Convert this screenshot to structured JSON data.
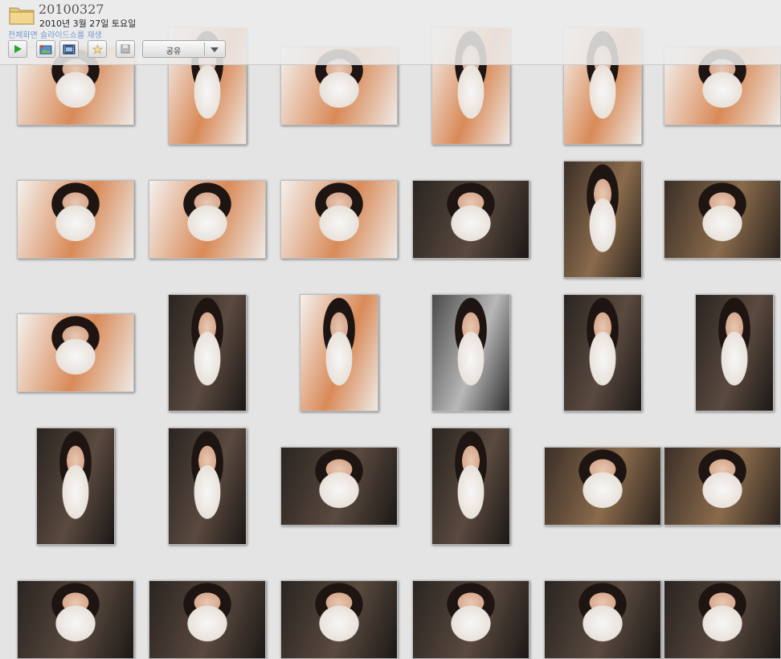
{
  "header": {
    "title": "20100327",
    "date": "2010년 3월 27일 토요일",
    "slideshow_link": "전체화면 슬라이드쇼를 재생",
    "share_label": "공유"
  },
  "toolbar": {
    "buttons": [
      {
        "name": "play-button",
        "icon": "play-icon"
      },
      {
        "name": "add-image-button",
        "icon": "add-image-icon"
      },
      {
        "name": "slideshow-button",
        "icon": "filmstrip-icon"
      },
      {
        "name": "favorite-button",
        "icon": "star-icon"
      },
      {
        "name": "save-button",
        "icon": "save-icon"
      }
    ]
  },
  "photos": [
    {
      "row": 0,
      "col": 0,
      "orientation": "landscape",
      "tone": "orange"
    },
    {
      "row": 0,
      "col": 1,
      "orientation": "portrait",
      "tone": "orange"
    },
    {
      "row": 0,
      "col": 2,
      "orientation": "landscape",
      "tone": "orange"
    },
    {
      "row": 0,
      "col": 3,
      "orientation": "portrait",
      "tone": "orange"
    },
    {
      "row": 0,
      "col": 4,
      "orientation": "portrait",
      "tone": "orange"
    },
    {
      "row": 0,
      "col": 5,
      "orientation": "landscape",
      "tone": "orange"
    },
    {
      "row": 1,
      "col": 0,
      "orientation": "landscape",
      "tone": "orange"
    },
    {
      "row": 1,
      "col": 1,
      "orientation": "landscape",
      "tone": "orange"
    },
    {
      "row": 1,
      "col": 2,
      "orientation": "landscape",
      "tone": "orange"
    },
    {
      "row": 1,
      "col": 3,
      "orientation": "landscape",
      "tone": "dark"
    },
    {
      "row": 1,
      "col": 4,
      "orientation": "portrait",
      "tone": "bokeh"
    },
    {
      "row": 1,
      "col": 5,
      "orientation": "landscape",
      "tone": "bokeh"
    },
    {
      "row": 2,
      "col": 0,
      "orientation": "landscape",
      "tone": "orange"
    },
    {
      "row": 2,
      "col": 1,
      "orientation": "portrait",
      "tone": "dark"
    },
    {
      "row": 2,
      "col": 2,
      "orientation": "portrait",
      "tone": "orange"
    },
    {
      "row": 2,
      "col": 3,
      "orientation": "portrait",
      "tone": "gray"
    },
    {
      "row": 2,
      "col": 4,
      "orientation": "portrait",
      "tone": "dark"
    },
    {
      "row": 2,
      "col": 5,
      "orientation": "portrait",
      "tone": "dark"
    },
    {
      "row": 3,
      "col": 0,
      "orientation": "portrait",
      "tone": "dark"
    },
    {
      "row": 3,
      "col": 1,
      "orientation": "portrait",
      "tone": "dark"
    },
    {
      "row": 3,
      "col": 2,
      "orientation": "landscape",
      "tone": "dark"
    },
    {
      "row": 3,
      "col": 3,
      "orientation": "portrait",
      "tone": "dark"
    },
    {
      "row": 3,
      "col": 4,
      "orientation": "landscape",
      "tone": "bokeh"
    },
    {
      "row": 3,
      "col": 5,
      "orientation": "landscape",
      "tone": "bokeh"
    },
    {
      "row": 4,
      "col": 0,
      "orientation": "landscape",
      "tone": "dark"
    },
    {
      "row": 4,
      "col": 1,
      "orientation": "landscape",
      "tone": "dark"
    },
    {
      "row": 4,
      "col": 2,
      "orientation": "landscape",
      "tone": "dark"
    },
    {
      "row": 4,
      "col": 3,
      "orientation": "landscape",
      "tone": "dark"
    },
    {
      "row": 4,
      "col": 4,
      "orientation": "landscape",
      "tone": "dark"
    },
    {
      "row": 4,
      "col": 5,
      "orientation": "landscape",
      "tone": "dark"
    }
  ],
  "colors": {
    "orange": "#d98a58",
    "dark": "#3a2f2a",
    "bokeh": "#6a5340",
    "gray": "#8c8c8c",
    "accent_link": "#7a9ad0"
  }
}
